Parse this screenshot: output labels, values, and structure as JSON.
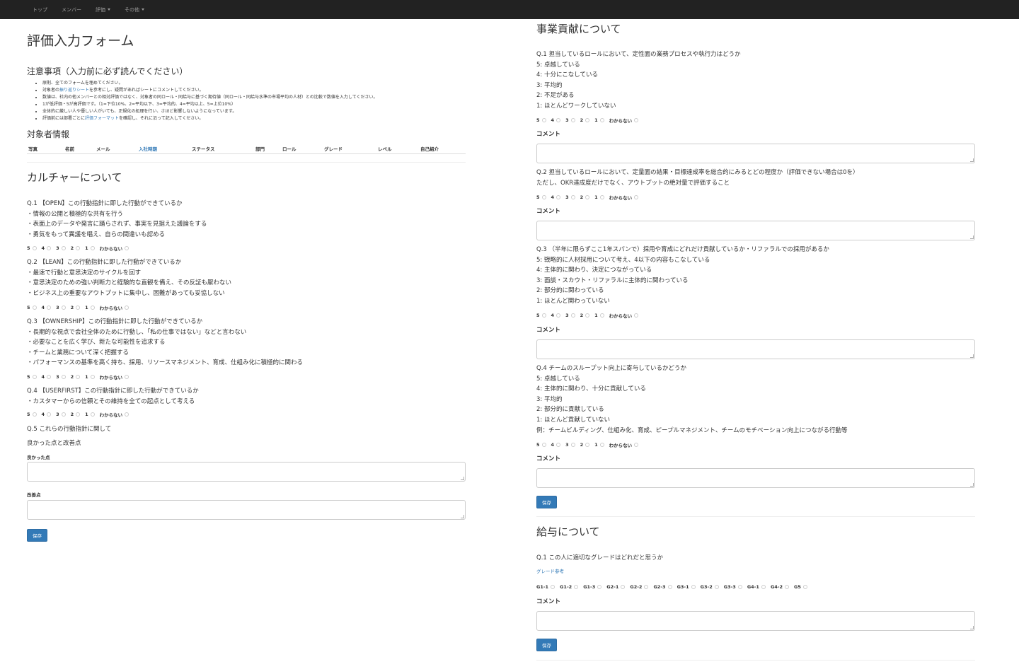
{
  "nav": {
    "items": [
      "トップ",
      "メンバー",
      "評価",
      "その他"
    ]
  },
  "left": {
    "title": "評価入力フォーム",
    "notes_title": "注意事項（入力前に必ず読んでください）",
    "notes": [
      "原則、全てのフォームを埋めてください。",
      "対象者の振り返りシートを参考にし、疑問があればシートにコメントしてください。",
      "数値は、社内の他メンバーとの相対評価ではなく、対象者の同ロール・同給与に基づく期待値（同ロール・同給与水準の市場平均の人材）との比較で数値を入力してください。",
      "1が低評価・5が高評価です。（1=下位10%、2=平均以下、3=平均的、4=平均以上、5=上位10%）",
      "全体的に厳しい人や優しい人がいても、正規化の処理を行い、さほど影響しないようになっています。",
      "評価前には部署ごとに評価フォーマットを確認し、それに沿って記入してください。"
    ],
    "subject_title": "対象者情報",
    "table_headers": [
      "写真",
      "名前",
      "メール",
      "入社時期",
      "ステータス",
      "部門",
      "ロール",
      "グレード",
      "レベル",
      "自己紹介"
    ],
    "culture_title": "カルチャーについて",
    "questions": [
      {
        "lines": [
          "Q.1 【OPEN】この行動指針に即した行動ができているか",
          "・情報の公開と積極的な共有を行う",
          "・表面上のデータや発言に踊らされず、事実を見据えた議論をする",
          "・勇気をもって異議を唱え、自らの間違いも認める"
        ]
      },
      {
        "lines": [
          "Q.2 【LEAN】この行動指針に即した行動ができているか",
          "・最速で行動と意思決定のサイクルを回す",
          "・意思決定のための強い判断力と経験的な直観を備え、その反証も厭わない",
          "・ビジネス上の重要なアウトプットに集中し、困難があっても妥協しない"
        ]
      },
      {
        "lines": [
          "Q.3 【OWNERSHIP】この行動指針に即した行動ができているか",
          "・長期的な視点で会社全体のために行動し、「私の仕事ではない」などと言わない",
          "・必要なことを広く学び、新たな可能性を追求する",
          "・チームと業務について深く把握する",
          "・パフォーマンスの基準を高く持ち、採用、リソースマネジメント、育成、仕組み化に積極的に関わる"
        ]
      },
      {
        "lines": [
          "Q.4 【USERFIRST】この行動指針に即した行動ができているか",
          "・カスタマーからの信頼とその維持を全ての起点として考える"
        ]
      }
    ],
    "q5": "Q.5 これらの行動指針に関して",
    "q5_sub": "良かった点と改善点",
    "good_label": "良かった点",
    "improve_label": "改善点",
    "save": "保存"
  },
  "rating_options": [
    "5",
    "4",
    "3",
    "2",
    "1",
    "わからない"
  ],
  "right": {
    "business_title": "事業貢献について",
    "questions": [
      {
        "lines": [
          "Q.1 担当しているロールにおいて、定性面の業務プロセスや執行力はどうか",
          "5: 卓越している",
          "4: 十分にこなしている",
          "3: 平均的",
          "2: 不足がある",
          "1: ほとんどワークしていない"
        ]
      },
      {
        "lines": [
          "Q.2 担当しているロールにおいて、定量面の結果・目標達成率を総合的にみるとどの程度か（評価できない場合は0を）",
          "ただし、OKR達成度だけでなく、アウトプットの絶対量で評価すること"
        ]
      },
      {
        "lines": [
          "Q.3 （半年に限らずここ1年スパンで）採用や育成にどれだけ貢献しているか・リファラルでの採用があるか",
          "5: 戦略的に人材採用について考え、4以下の内容もこなしている",
          "4: 主体的に関わり、決定につながっている",
          "3: 面談・スカウト・リファラルに主体的に関わっている",
          "2: 部分的に関わっている",
          "1: ほとんど関わっていない"
        ]
      },
      {
        "lines": [
          "Q.4 チームのスループット向上に寄与しているかどうか",
          "5: 卓越している",
          "4: 主体的に関わり、十分に貢献している",
          "3: 平均的",
          "2: 部分的に貢献している",
          "1: ほとんど貢献していない",
          "例：チームビルディング、仕組み化、育成、ピープルマネジメント、チームのモチベーション向上につながる行動等"
        ]
      }
    ],
    "comment_label": "コメント",
    "save": "保存",
    "salary_title": "給与について",
    "salary_q": "Q.1 この人に適切なグレードはどれだと思うか",
    "grade_link": "グレード参考",
    "grades": [
      "G1-1",
      "G1-2",
      "G1-3",
      "G2-1",
      "G2-2",
      "G2-3",
      "G3-1",
      "G3-2",
      "G3-3",
      "G4-1",
      "G4-2",
      "G5"
    ]
  }
}
